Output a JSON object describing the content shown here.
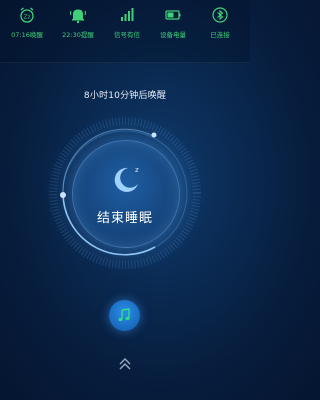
{
  "status": {
    "items": [
      {
        "icon": "alarm-clock-icon",
        "label": "07:16唤醒"
      },
      {
        "icon": "bell-icon",
        "label": "22:30提醒"
      },
      {
        "icon": "signal-icon",
        "label": "信号有信"
      },
      {
        "icon": "battery-icon",
        "label": "设备电量"
      },
      {
        "icon": "bluetooth-icon",
        "label": "已连接"
      }
    ],
    "label_color": "#3fd17a"
  },
  "wake_info": "8小时10分钟后唤醒",
  "main_button": "结束睡眠",
  "colors": {
    "accent": "#2c8ee6",
    "background": "#071d3d"
  }
}
